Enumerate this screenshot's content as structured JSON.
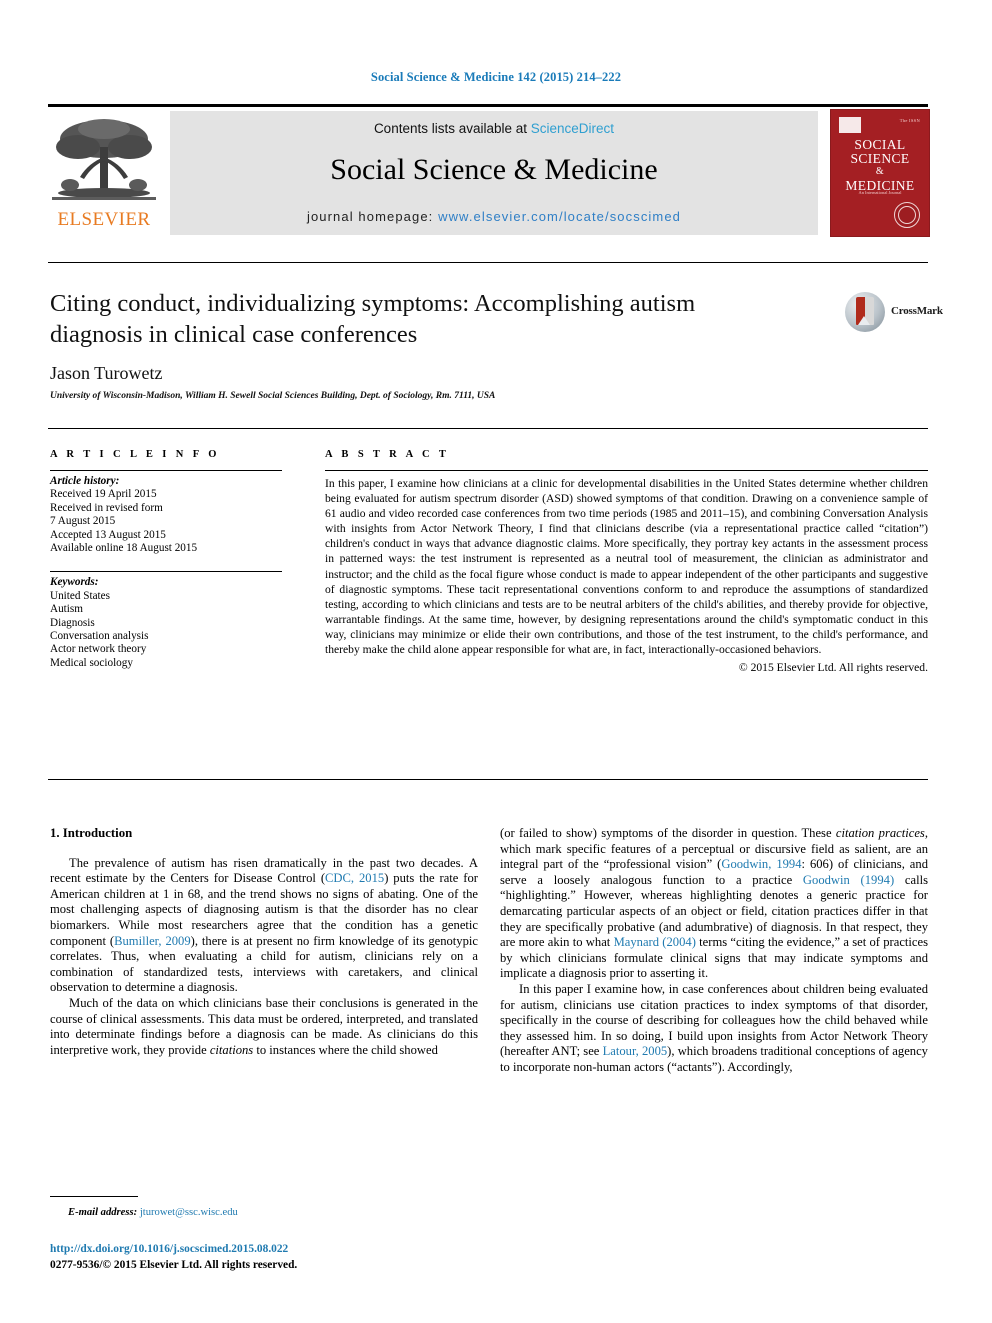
{
  "running_head": "Social Science & Medicine 142 (2015) 214–222",
  "masthead": {
    "publisher_logo_label": "ELSEVIER",
    "contents_prefix": "Contents lists available at ",
    "contents_link": "ScienceDirect",
    "journal_name": "Social Science & Medicine",
    "homepage_prefix": "journal homepage: ",
    "homepage_url": "www.elsevier.com/locate/socscimed",
    "cover": {
      "line1": "SOCIAL",
      "line2": "SCIENCE",
      "line3": "&",
      "line4": "MEDICINE",
      "tagline": "An International Journal",
      "corner_note": "The ISSN"
    },
    "colors": {
      "link": "#2f9fd0",
      "homepage_link": "#2f7fc6",
      "elsevier_orange": "#e87b22",
      "cover_red": "#a41f23",
      "running_head_blue": "#1a7bb9"
    }
  },
  "article": {
    "title": "Citing conduct, individualizing symptoms: Accomplishing autism diagnosis in clinical case conferences",
    "author": "Jason Turowetz",
    "affiliation": "University of Wisconsin-Madison, William H. Sewell Social Sciences Building, Dept. of Sociology, Rm. 7111, USA",
    "crossmark_label": "CrossMark"
  },
  "article_info": {
    "heading": "A R T I C L E   I N F O",
    "history_label": "Article history:",
    "history": [
      "Received 19 April 2015",
      "Received in revised form",
      "7 August 2015",
      "Accepted 13 August 2015",
      "Available online 18 August 2015"
    ],
    "keywords_label": "Keywords:",
    "keywords": [
      "United States",
      "Autism",
      "Diagnosis",
      "Conversation analysis",
      "Actor network theory",
      "Medical sociology"
    ]
  },
  "abstract": {
    "heading": "A B S T R A C T",
    "text": "In this paper, I examine how clinicians at a clinic for developmental disabilities in the United States determine whether children being evaluated for autism spectrum disorder (ASD) showed symptoms of that condition. Drawing on a convenience sample of 61 audio and video recorded case conferences from two time periods (1985 and 2011–15), and combining Conversation Analysis with insights from Actor Network Theory, I find that clinicians describe (via a representational practice called “citation”) children's conduct in ways that advance diagnostic claims. More specifically, they portray key actants in the assessment process in patterned ways: the test instrument is represented as a neutral tool of measurement, the clinician as administrator and instructor; and the child as the focal figure whose conduct is made to appear independent of the other participants and suggestive of diagnostic symptoms. These tacit representational conventions conform to and reproduce the assumptions of standardized testing, according to which clinicians and tests are to be neutral arbiters of the child's abilities, and thereby provide for objective, warrantable findings. At the same time, however, by designing representations around the child's symptomatic conduct in this way, clinicians may minimize or elide their own contributions, and those of the test instrument, to the child's performance, and thereby make the child alone appear responsible for what are, in fact, interactionally-occasioned behaviors.",
    "copyright": "© 2015 Elsevier Ltd. All rights reserved."
  },
  "body": {
    "section_heading": "1. Introduction",
    "left_paragraphs": [
      "The prevalence of autism has risen dramatically in the past two decades. A recent estimate by the Centers for Disease Control (CDC, 2015) puts the rate for American children at 1 in 68, and the trend shows no signs of abating. One of the most challenging aspects of diagnosing autism is that the disorder has no clear biomarkers. While most researchers agree that the condition has a genetic component (Bumiller, 2009), there is at present no firm knowledge of its genotypic correlates. Thus, when evaluating a child for autism, clinicians rely on a combination of standardized tests, interviews with caretakers, and clinical observation to determine a diagnosis.",
      "Much of the data on which clinicians base their conclusions is generated in the course of clinical assessments. This data must be ordered, interpreted, and translated into determinate findings before a diagnosis can be made. As clinicians do this interpretive work, they provide citations to instances where the child showed"
    ],
    "right_paragraphs": [
      "(or failed to show) symptoms of the disorder in question. These citation practices, which mark specific features of a perceptual or discursive field as salient, are an integral part of the “professional vision” (Goodwin, 1994: 606) of clinicians, and serve a loosely analogous function to a practice Goodwin (1994) calls “highlighting.” However, whereas highlighting denotes a generic practice for demarcating particular aspects of an object or field, citation practices differ in that they are specifically probative (and adumbrative) of diagnosis. In that respect, they are more akin to what Maynard (2004) terms “citing the evidence,” a set of practices by which clinicians formulate clinical signs that may indicate symptoms and implicate a diagnosis prior to asserting it.",
      "In this paper I examine how, in case conferences about children being evaluated for autism, clinicians use citation practices to index symptoms of that disorder, specifically in the course of describing for colleagues how the child behaved while they assessed him. In so doing, I build upon insights from Actor Network Theory (hereafter ANT; see Latour, 2005), which broadens traditional conceptions of agency to incorporate non-human actors (“actants”). Accordingly,"
    ],
    "references_inline": [
      "CDC, 2015",
      "Bumiller, 2009",
      "Goodwin, 1994",
      "Goodwin (1994)",
      "Maynard (2004)",
      "Latour, 2005"
    ]
  },
  "footer": {
    "email_label": "E-mail address:",
    "email": "jturowet@ssc.wisc.edu",
    "doi": "http://dx.doi.org/10.1016/j.socscimed.2015.08.022",
    "copyright": "0277-9536/© 2015 Elsevier Ltd. All rights reserved."
  }
}
